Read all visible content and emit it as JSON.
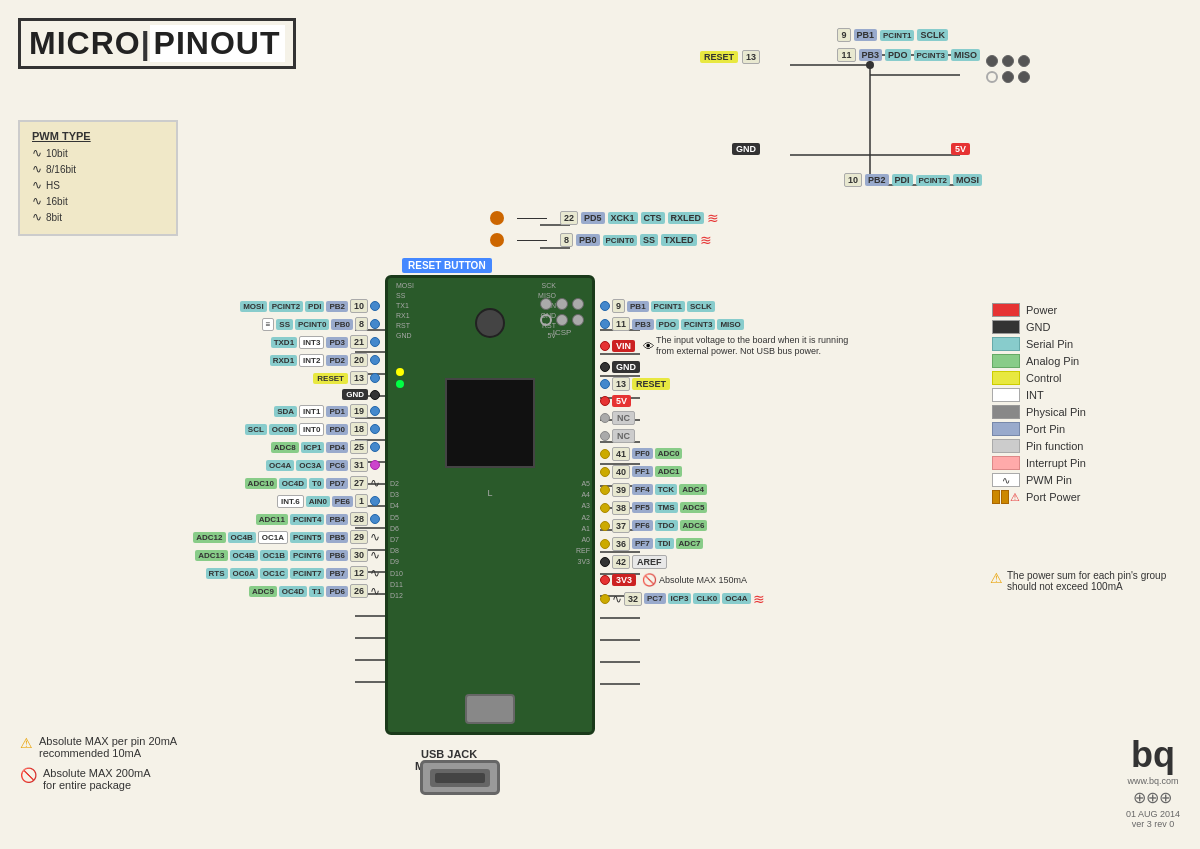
{
  "title": {
    "micro": "MICRO",
    "pinout": "PINOUT"
  },
  "pwm": {
    "title": "PWM TYPE",
    "items": [
      {
        "wave": "~",
        "label": "10bit"
      },
      {
        "wave": "~",
        "label": "8/16bit"
      },
      {
        "wave": "~",
        "label": "HS"
      },
      {
        "wave": "~",
        "label": "16bit"
      },
      {
        "wave": "~",
        "label": "8bit"
      }
    ]
  },
  "legend": {
    "items": [
      {
        "color": "#e63333",
        "label": "Power"
      },
      {
        "color": "#333333",
        "label": "GND"
      },
      {
        "color": "#88cccc",
        "label": "Serial Pin"
      },
      {
        "color": "#88cc88",
        "label": "Analog Pin"
      },
      {
        "color": "#e8e840",
        "label": "Control"
      },
      {
        "color": "#ffffff",
        "label": "INT"
      },
      {
        "color": "#888888",
        "label": "Physical Pin"
      },
      {
        "color": "#99aacc",
        "label": "Port Pin"
      },
      {
        "color": "#cccccc",
        "label": "Pin function"
      },
      {
        "color": "#ffaaaa",
        "label": "Interrupt Pin"
      },
      {
        "color": "#ffffff",
        "label": "PWM Pin"
      },
      {
        "color": "#cc8800",
        "label": "Port Power"
      }
    ]
  },
  "top_right_pins": {
    "pin9": {
      "num": "9",
      "port": "PB1",
      "func1": "PCINT1",
      "func2": "SCLK"
    },
    "pin11": {
      "num": "11",
      "port": "PB3",
      "func1": "PDO",
      "func2": "PCINT3",
      "func3": "MISO"
    },
    "pin10": {
      "num": "10",
      "port": "PB2",
      "func1": "PDI",
      "func2": "PCINT2",
      "func3": "MOSI"
    },
    "reset13": {
      "num": "13",
      "label": "RESET"
    },
    "gnd": {
      "label": "GND"
    },
    "fivev": {
      "label": "5V"
    }
  },
  "top_middle_pins": {
    "pin22": {
      "num": "22",
      "port": "PD5",
      "func1": "XCK1",
      "func2": "CTS",
      "func3": "RXLED"
    },
    "pin8": {
      "num": "8",
      "port": "PB0",
      "func1": "PCINT0",
      "func2": "SS",
      "func3": "TXLED"
    }
  },
  "left_pins": [
    {
      "num": "10",
      "labels": [
        "MOSI",
        "PCINT2",
        "PDI",
        "PB2"
      ]
    },
    {
      "num": "8",
      "labels": [
        "SS",
        "PCINT0",
        "PB0"
      ]
    },
    {
      "num": "21",
      "labels": [
        "TXD1",
        "INT3",
        "PD3"
      ]
    },
    {
      "num": "20",
      "labels": [
        "RXD1",
        "INT2",
        "PD2"
      ]
    },
    {
      "num": "13",
      "labels": [
        "RESET"
      ],
      "special": "reset"
    },
    {
      "num": "",
      "labels": [
        "GND"
      ],
      "special": "gnd"
    },
    {
      "num": "19",
      "labels": [
        "SDA",
        "INT1",
        "PD1"
      ]
    },
    {
      "num": "18",
      "labels": [
        "SCL",
        "OC0B",
        "INT0",
        "PD0"
      ]
    },
    {
      "num": "25",
      "labels": [
        "ADC8",
        "ICP1",
        "PD4"
      ]
    },
    {
      "num": "31",
      "labels": [
        "OC4A",
        "OC3A",
        "PC6"
      ]
    },
    {
      "num": "27",
      "labels": [
        "ADC10",
        "OC4D",
        "T0",
        "PD7"
      ]
    },
    {
      "num": "1",
      "labels": [
        "INT.6",
        "AIN0",
        "PE6"
      ]
    },
    {
      "num": "28",
      "labels": [
        "ADC11",
        "PCINT4",
        "PB4"
      ]
    },
    {
      "num": "29",
      "labels": [
        "ADC12",
        "OC4B",
        "PCINT5",
        "PB5"
      ]
    },
    {
      "num": "30",
      "labels": [
        "ADC13",
        "OC4B",
        "OC1B",
        "PCINT6",
        "PB6"
      ]
    },
    {
      "num": "12",
      "labels": [
        "RTS",
        "OC0A",
        "OC1C",
        "PCINT7",
        "PB7"
      ]
    },
    {
      "num": "26",
      "labels": [
        "ADC9",
        "OC4D",
        "T1",
        "PD6"
      ]
    }
  ],
  "right_pins": [
    {
      "num": "9",
      "labels": [
        "PB1",
        "PCINT1",
        "SCLK"
      ]
    },
    {
      "num": "11",
      "labels": [
        "PB3",
        "PDO",
        "PCINT3",
        "MISO"
      ]
    },
    {
      "label": "VIN",
      "special": "vin"
    },
    {
      "label": "GND",
      "special": "gnd"
    },
    {
      "num": "13",
      "label": "RESET",
      "special": "reset"
    },
    {
      "label": "5V",
      "special": "fivev"
    },
    {
      "label": "NC",
      "special": "nc"
    },
    {
      "label": "NC",
      "special": "nc"
    },
    {
      "num": "41",
      "labels": [
        "PF0",
        "ADC0"
      ]
    },
    {
      "num": "40",
      "labels": [
        "PF1",
        "ADC1"
      ]
    },
    {
      "num": "39",
      "labels": [
        "PF4",
        "TCK",
        "ADC4"
      ]
    },
    {
      "num": "38",
      "labels": [
        "PF5",
        "TMS",
        "ADC5"
      ]
    },
    {
      "num": "37",
      "labels": [
        "PF6",
        "TDO",
        "ADC6"
      ]
    },
    {
      "num": "36",
      "labels": [
        "PF7",
        "TDI",
        "ADC7"
      ]
    },
    {
      "num": "42",
      "label": "AREF",
      "special": "aref"
    },
    {
      "label": "3V3",
      "special": "threev"
    },
    {
      "num": "32",
      "labels": [
        "PC7",
        "ICP3",
        "CLK0",
        "OC4A"
      ]
    }
  ],
  "info": {
    "vin_text": "The input voltage to the board when it is running from external power. Not USB bus power."
  },
  "warnings": {
    "abs_max_pin": "Absolute MAX per pin 20mA\nrecommended 10mA",
    "abs_max_package": "Absolute MAX 200mA\nfor entire package"
  },
  "power_warning": "The power sum for each pin's group should not exceed 100mA",
  "usb_label": "USB JACK\nMicro Type B",
  "board_labels": {
    "reset_button": "RESET BUTTON",
    "icsp": "ICSP"
  },
  "copyright": {
    "website": "www.bq.com",
    "date": "01 AUG 2014",
    "version": "ver 3 rev 0",
    "logo": "bq"
  }
}
